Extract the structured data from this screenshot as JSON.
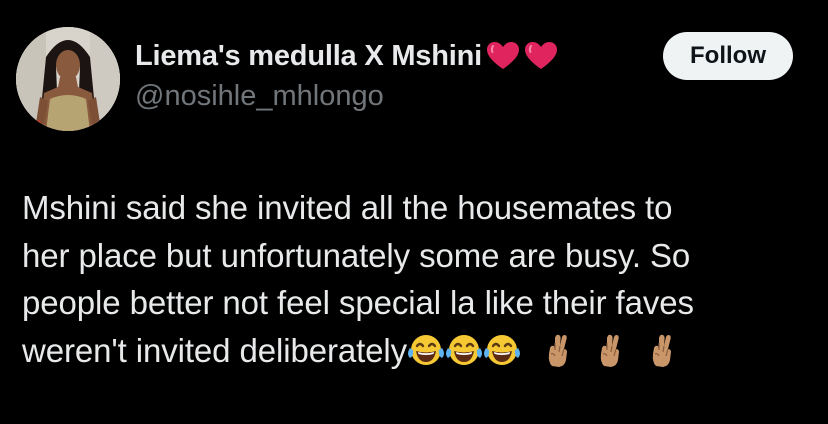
{
  "tweet": {
    "author": {
      "display_name": "Liema's medulla X Mshini",
      "handle": "@nosihle_mhlongo",
      "name_emojis": [
        "heart-icon",
        "heart-icon"
      ]
    },
    "follow_label": "Follow",
    "text_lines": [
      "Mshini said she invited all the housemates to",
      "her place but unfortunately some are busy. So",
      "people better not feel special la like their faves",
      "weren't invited deliberately"
    ],
    "trailing_emojis": [
      "laughing-tears-emoji",
      "laughing-tears-emoji",
      "laughing-tears-emoji",
      "crossed-fingers-emoji",
      "crossed-fingers-emoji",
      "crossed-fingers-emoji"
    ]
  },
  "colors": {
    "background": "#000000",
    "primary_text": "#e7e9ea",
    "secondary_text": "#71767b",
    "follow_button_bg": "#eff3f4",
    "follow_button_text": "#0f1419",
    "heart": "#e0245e"
  }
}
